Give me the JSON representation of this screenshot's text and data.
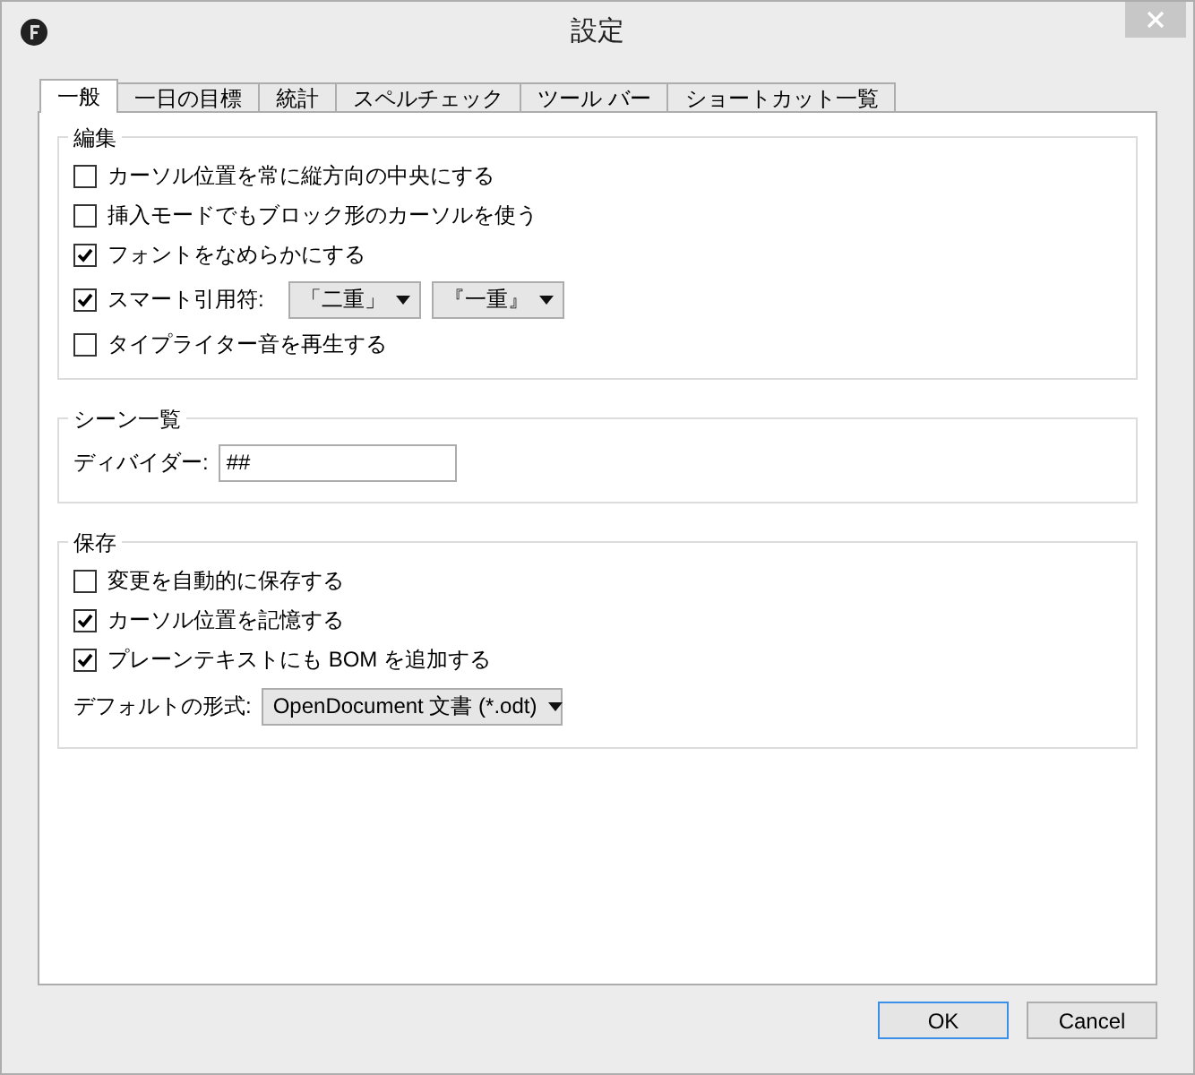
{
  "window": {
    "title": "設定"
  },
  "tabs": [
    {
      "label": "一般",
      "selected": true
    },
    {
      "label": "一日の目標",
      "selected": false
    },
    {
      "label": "統計",
      "selected": false
    },
    {
      "label": "スペルチェック",
      "selected": false
    },
    {
      "label": "ツール バー",
      "selected": false
    },
    {
      "label": "ショートカット一覧",
      "selected": false
    }
  ],
  "sections": [
    {
      "title": "編集",
      "rows": [
        {
          "kind": "checkbox",
          "label": "カーソル位置を常に縦方向の中央にする",
          "checked": false
        },
        {
          "kind": "checkbox",
          "label": "挿入モードでもブロック形のカーソルを使う",
          "checked": false
        },
        {
          "kind": "checkbox",
          "label": "フォントをなめらかにする",
          "checked": true
        },
        {
          "kind": "checkbox",
          "label": "スマート引用符:",
          "checked": true,
          "dropdowns": [
            "「二重」",
            "『一重』"
          ]
        },
        {
          "kind": "checkbox",
          "label": "タイプライター音を再生する",
          "checked": false
        }
      ]
    },
    {
      "title": "シーン一覧",
      "rows": [
        {
          "kind": "field",
          "label": "ディバイダー:",
          "value": "##"
        }
      ]
    },
    {
      "title": "保存",
      "rows": [
        {
          "kind": "checkbox",
          "label": "変更を自動的に保存する",
          "checked": false
        },
        {
          "kind": "checkbox",
          "label": "カーソル位置を記憶する",
          "checked": true
        },
        {
          "kind": "checkbox",
          "label": "プレーンテキストにも BOM を追加する",
          "checked": true
        },
        {
          "kind": "dropdown",
          "label": "デフォルトの形式:",
          "value": "OpenDocument 文書 (*.odt)"
        }
      ]
    }
  ],
  "buttons": [
    {
      "label": "OK",
      "default": true
    },
    {
      "label": "Cancel",
      "default": false
    }
  ]
}
